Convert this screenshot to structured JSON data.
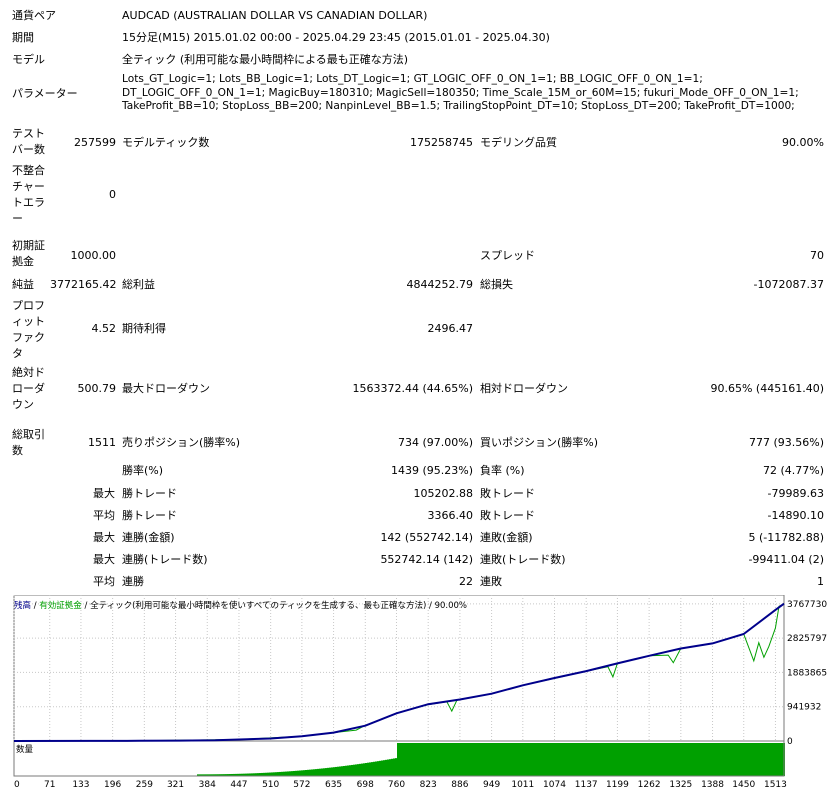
{
  "report": {
    "symbol": {
      "label": "通貨ペア",
      "value": "AUDCAD (AUSTRALIAN DOLLAR VS CANADIAN DOLLAR)"
    },
    "period": {
      "label": "期間",
      "value": "15分足(M15) 2015.01.02 00:00 - 2025.04.29 23:45 (2015.01.01 - 2025.04.30)"
    },
    "model": {
      "label": "モデル",
      "value": "全ティック (利用可能な最小時間枠による最も正確な方法)"
    },
    "parameters": {
      "label": "パラメーター",
      "value": "Lots_GT_Logic=1; Lots_BB_Logic=1; Lots_DT_Logic=1; GT_LOGIC_OFF_0_ON_1=1; BB_LOGIC_OFF_0_ON_1=1; DT_LOGIC_OFF_0_ON_1=1; MagicBuy=180310; MagicSell=180350; Time_Scale_15M_or_60M=15; fukuri_Mode_OFF_0_ON_1=1; TakeProfit_BB=10; StopLoss_BB=200; NanpinLevel_BB=1.5; TrailingStopPoint_DT=10; StopLoss_DT=200; TakeProfit_DT=1000;"
    },
    "rows": {
      "bars": {
        "label": "テストバー数",
        "value": "257599",
        "label2": "モデルティック数",
        "value2": "175258745",
        "label3": "モデリング品質",
        "value3": "90.00%"
      },
      "mismatch": {
        "label": "不整合チャートエラー",
        "value": "0"
      },
      "deposit": {
        "label": "初期証拠金",
        "value": "1000.00",
        "label3": "スプレッド",
        "value3": "70"
      },
      "net": {
        "label": "純益",
        "value": "3772165.42",
        "label2": "総利益",
        "value2": "4844252.79",
        "label3": "総損失",
        "value3": "-1072087.37"
      },
      "pf": {
        "label": "プロフィットファクタ",
        "value": "4.52",
        "label2": "期待利得",
        "value2": "2496.47"
      },
      "absdd": {
        "label": "絶対ドローダウン",
        "value": "500.79",
        "label2": "最大ドローダウン",
        "value2": "1563372.44 (44.65%)",
        "label3": "相対ドローダウン",
        "value3": "90.65% (445161.40)"
      },
      "trades": {
        "label": "総取引数",
        "value": "1511",
        "label2": "売りポジション(勝率%)",
        "value2": "734 (97.00%)",
        "label3": "買いポジション(勝率%)",
        "value3": "777 (93.56%)"
      },
      "winrate": {
        "label2": "勝率(%)",
        "value2": "1439 (95.23%)",
        "label3": "負率 (%)",
        "value3": "72 (4.77%)"
      },
      "maxtrade": {
        "prefix": "最大",
        "label2": "勝トレード",
        "value2": "105202.88",
        "label3": "敗トレード",
        "value3": "-79989.63"
      },
      "avgtrade": {
        "prefix": "平均",
        "label2": "勝トレード",
        "value2": "3366.40",
        "label3": "敗トレード",
        "value3": "-14890.10"
      },
      "maxcons": {
        "prefix": "最大",
        "label2": "連勝(金額)",
        "value2": "142 (552742.14)",
        "label3": "連敗(金額)",
        "value3": "5 (-11782.88)"
      },
      "maxconsn": {
        "prefix": "最大",
        "label2": "連勝(トレード数)",
        "value2": "552742.14 (142)",
        "label3": "連敗(トレード数)",
        "value3": "-99411.04 (2)"
      },
      "avgcons": {
        "prefix": "平均",
        "label2": "連勝",
        "value2": "22",
        "label3": "連敗",
        "value3": "1"
      }
    }
  },
  "chart": {
    "legend": {
      "balance": "残高",
      "sep1": " / ",
      "equity": "有効証拠金",
      "sep2": " / ",
      "model": "全ティック(利用可能な最小時間枠を使いすべてのティックを生成する、最も正確な方法)",
      "sep3": " / ",
      "quality": "90.00%"
    },
    "volume_label": "数量",
    "colors": {
      "balance": "#00008b",
      "equity": "#00a000",
      "volume": "#00a000",
      "grid": "#c8c8c8"
    }
  },
  "chart_data": {
    "type": "line",
    "x_ticks": [
      "0",
      "71",
      "133",
      "196",
      "259",
      "321",
      "384",
      "447",
      "510",
      "572",
      "635",
      "698",
      "760",
      "823",
      "886",
      "949",
      "1011",
      "1074",
      "1137",
      "1199",
      "1262",
      "1325",
      "1388",
      "1450",
      "1513"
    ],
    "y_ticks": [
      "3767730",
      "2825797",
      "1883865",
      "941932",
      "0"
    ],
    "ylim": [
      0,
      3900000
    ],
    "xlim": [
      0,
      1530
    ],
    "series": [
      {
        "name": "残高",
        "points": [
          [
            0,
            1000
          ],
          [
            150,
            2000
          ],
          [
            250,
            5000
          ],
          [
            330,
            10000
          ],
          [
            400,
            20000
          ],
          [
            447,
            40000
          ],
          [
            510,
            70000
          ],
          [
            572,
            130000
          ],
          [
            635,
            230000
          ],
          [
            698,
            420000
          ],
          [
            760,
            760000
          ],
          [
            823,
            1010000
          ],
          [
            886,
            1140000
          ],
          [
            949,
            1300000
          ],
          [
            1011,
            1530000
          ],
          [
            1074,
            1730000
          ],
          [
            1137,
            1920000
          ],
          [
            1199,
            2130000
          ],
          [
            1262,
            2340000
          ],
          [
            1325,
            2540000
          ],
          [
            1388,
            2680000
          ],
          [
            1450,
            2940000
          ],
          [
            1513,
            3600000
          ],
          [
            1530,
            3772165
          ]
        ]
      },
      {
        "name": "有効証拠金",
        "points": [
          [
            0,
            1000
          ],
          [
            250,
            5000
          ],
          [
            447,
            40000
          ],
          [
            572,
            130000
          ],
          [
            635,
            230000
          ],
          [
            680,
            300000
          ],
          [
            698,
            430000
          ],
          [
            760,
            760000
          ],
          [
            823,
            1000000
          ],
          [
            860,
            1080000
          ],
          [
            870,
            820000
          ],
          [
            880,
            1120000
          ],
          [
            949,
            1300000
          ],
          [
            1011,
            1530000
          ],
          [
            1074,
            1720000
          ],
          [
            1137,
            1920000
          ],
          [
            1180,
            2040000
          ],
          [
            1190,
            1760000
          ],
          [
            1199,
            2130000
          ],
          [
            1262,
            2340000
          ],
          [
            1300,
            2360000
          ],
          [
            1310,
            2150000
          ],
          [
            1325,
            2540000
          ],
          [
            1388,
            2680000
          ],
          [
            1450,
            2940000
          ],
          [
            1470,
            2200000
          ],
          [
            1480,
            2700000
          ],
          [
            1490,
            2300000
          ],
          [
            1500,
            2600000
          ],
          [
            1513,
            3100000
          ],
          [
            1520,
            3700000
          ],
          [
            1530,
            3772165
          ]
        ]
      }
    ],
    "volume_level_start": 0.05,
    "volume_level_full": 1.0
  }
}
